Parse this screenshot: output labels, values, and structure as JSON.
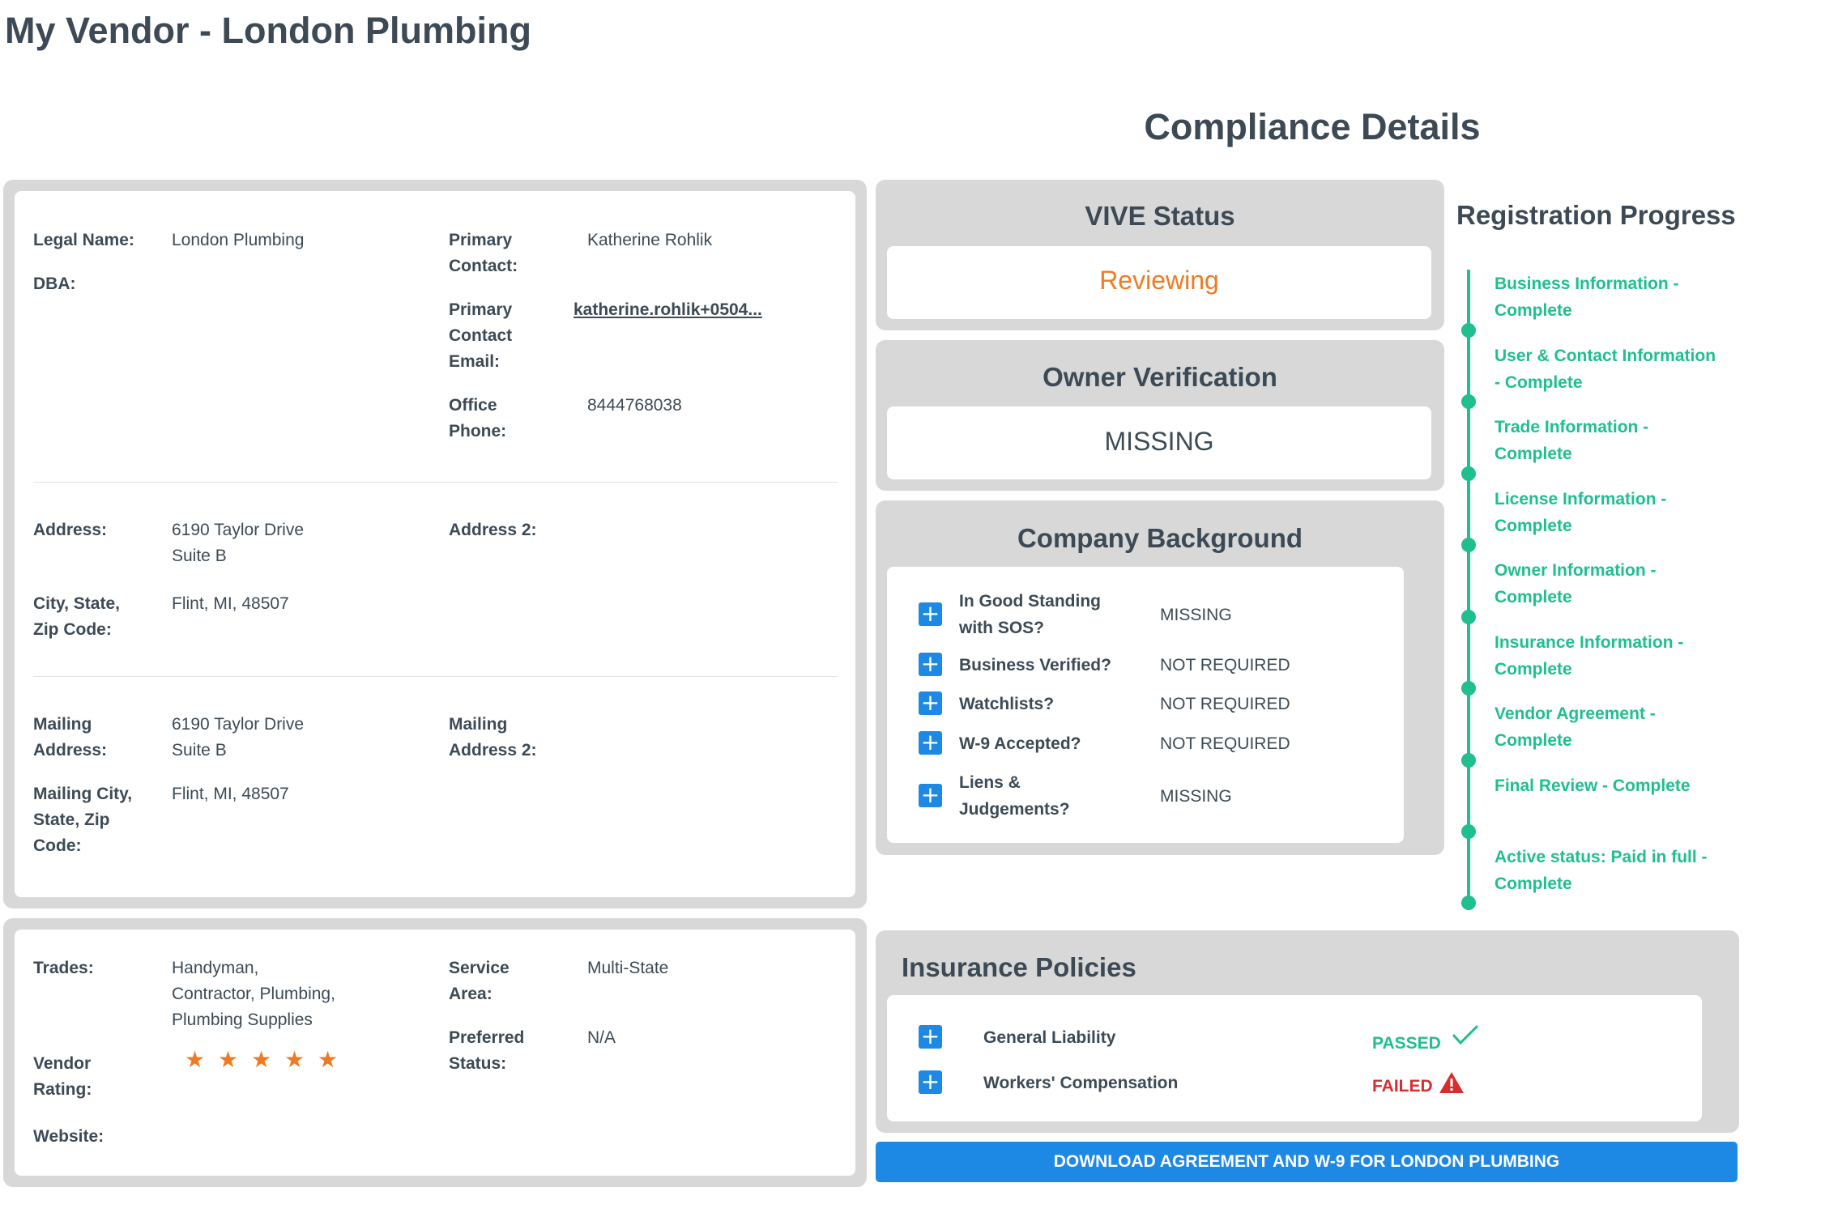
{
  "page_title": "My Vendor - London Plumbing",
  "compliance_title": "Compliance Details",
  "vendor_info": {
    "legal_name_label": "Legal Name:",
    "legal_name": "London Plumbing",
    "dba_label": "DBA:",
    "primary_contact_label_1": "Primary",
    "primary_contact_label_2": "Contact:",
    "primary_contact": "Katherine Rohlik",
    "primary_email_label_1": "Primary",
    "primary_email_label_2": "Contact",
    "primary_email_label_3": "Email:",
    "primary_email": "katherine.rohlik+0504...",
    "office_phone_label_1": "Office",
    "office_phone_label_2": "Phone:",
    "office_phone": "8444768038",
    "address_label": "Address:",
    "address_line1": "6190 Taylor Drive",
    "address_line2": "Suite B",
    "address2_label": "Address 2:",
    "city_label_1": "City, State,",
    "city_label_2": "Zip Code:",
    "city_value": "Flint, MI, 48507",
    "mailing_label_1": "Mailing",
    "mailing_label_2": "Address:",
    "mailing_line1": "6190 Taylor Drive",
    "mailing_line2": "Suite B",
    "mailing2_label_1": "Mailing",
    "mailing2_label_2": "Address 2:",
    "mailing_city_label_1": "Mailing City,",
    "mailing_city_label_2": "State, Zip",
    "mailing_city_label_3": "Code:",
    "mailing_city_value": "Flint, MI, 48507"
  },
  "trade_info": {
    "trades_label": "Trades:",
    "trades_line1": "Handyman,",
    "trades_line2": "Contractor, Plumbing,",
    "trades_line3": "Plumbing Supplies",
    "service_area_label_1": "Service",
    "service_area_label_2": "Area:",
    "service_area": "Multi-State",
    "preferred_label_1": "Preferred",
    "preferred_label_2": "Status:",
    "preferred_value": "N/A",
    "rating_label_1": "Vendor",
    "rating_label_2": "Rating:",
    "rating_stars": 5,
    "website_label": "Website:"
  },
  "vive_status": {
    "title": "VIVE Status",
    "value": "Reviewing",
    "color": "#f07a22"
  },
  "owner_verification": {
    "title": "Owner Verification",
    "value": "MISSING"
  },
  "company_background": {
    "title": "Company Background",
    "items": [
      {
        "label_1": "In Good Standing",
        "label_2": "with SOS?",
        "value": "MISSING"
      },
      {
        "label_1": "Business Verified?",
        "label_2": "",
        "value": "NOT REQUIRED"
      },
      {
        "label_1": "Watchlists?",
        "label_2": "",
        "value": "NOT REQUIRED"
      },
      {
        "label_1": "W-9 Accepted?",
        "label_2": "",
        "value": "NOT REQUIRED"
      },
      {
        "label_1": "Liens &",
        "label_2": "Judgements?",
        "value": "MISSING"
      }
    ]
  },
  "registration_progress": {
    "title": "Registration Progress",
    "color": "#1fbf8f",
    "steps": [
      {
        "line1": "Business Information -",
        "line2": "Complete"
      },
      {
        "line1": "User & Contact Information",
        "line2": "- Complete"
      },
      {
        "line1": "Trade Information -",
        "line2": "Complete"
      },
      {
        "line1": "License Information -",
        "line2": "Complete"
      },
      {
        "line1": "Owner Information -",
        "line2": "Complete"
      },
      {
        "line1": "Insurance Information -",
        "line2": "Complete"
      },
      {
        "line1": "Vendor Agreement -",
        "line2": "Complete"
      },
      {
        "line1": "Final Review - Complete",
        "line2": ""
      },
      {
        "line1": "Active status: Paid in full -",
        "line2": "Complete"
      }
    ]
  },
  "insurance": {
    "title": "Insurance Policies",
    "policies": [
      {
        "name": "General Liability",
        "status": "PASSED",
        "icon": "check-icon",
        "color": "#1fbf8f"
      },
      {
        "name": "Workers' Compensation",
        "status": "FAILED",
        "icon": "warning-icon",
        "color": "#d32f2f"
      }
    ]
  },
  "download_button": "DOWNLOAD AGREEMENT AND W-9 FOR LONDON PLUMBING"
}
